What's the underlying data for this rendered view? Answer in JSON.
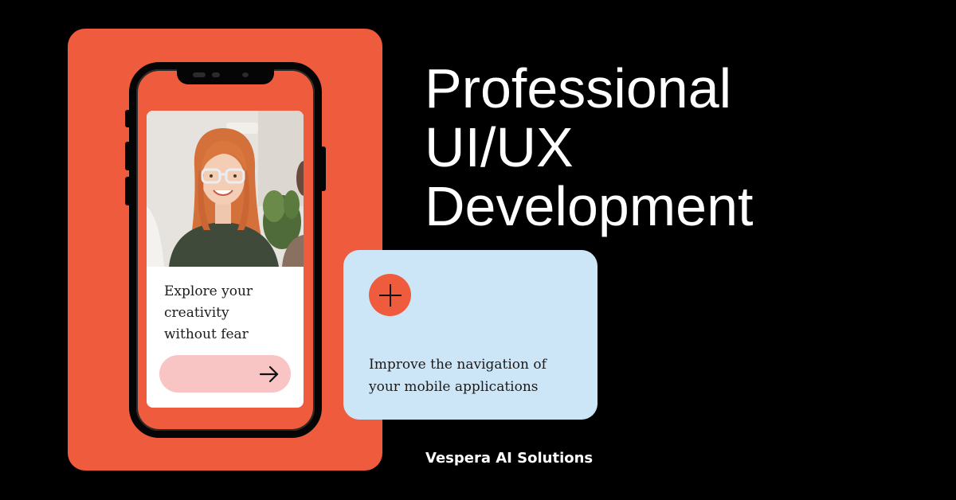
{
  "colors": {
    "orange": "#ef5b3d",
    "light_blue": "#cde6f7",
    "pink": "#f8c4c4",
    "black": "#000000"
  },
  "headline": {
    "line1": "Professional",
    "line2": "UI/UX",
    "line3": "Development"
  },
  "phone_card": {
    "tagline_line1": "Explore your",
    "tagline_line2": "creativity",
    "tagline_line3": "without fear",
    "cta_icon": "arrow-right-icon"
  },
  "info_card": {
    "icon": "plus-icon",
    "text_line1": "Improve the navigation of",
    "text_line2": "your mobile applications"
  },
  "brand": {
    "name": "Vespera AI Solutions"
  }
}
